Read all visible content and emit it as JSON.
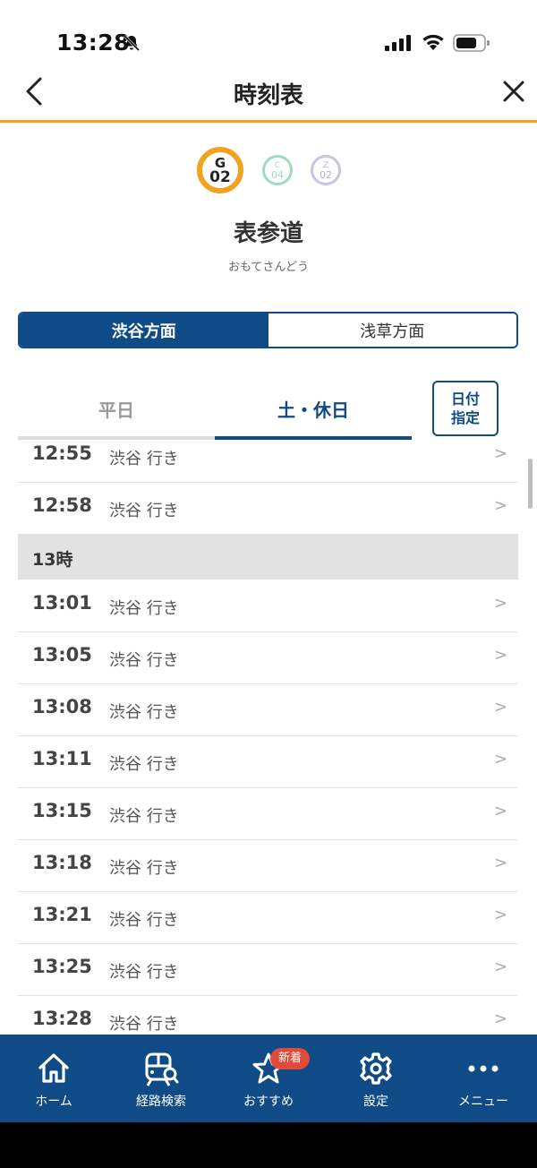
{
  "status_bar": {
    "time": "13:28"
  },
  "header": {
    "title": "時刻表"
  },
  "station": {
    "badges": [
      {
        "letter": "G",
        "number": "02"
      },
      {
        "letter": "C",
        "number": "04"
      },
      {
        "letter": "Z",
        "number": "02"
      }
    ],
    "name": "表参道",
    "reading": "おもてさんどう"
  },
  "directions": [
    {
      "label": "渋谷方面",
      "selected": true
    },
    {
      "label": "浅草方面",
      "selected": false
    }
  ],
  "day_tabs": [
    {
      "label": "平日",
      "selected": false
    },
    {
      "label": "土・休日",
      "selected": true
    }
  ],
  "date_button": {
    "line1": "日付",
    "line2": "指定"
  },
  "timetable": {
    "before": [
      {
        "time": "12:55",
        "dest": "渋谷 行き"
      },
      {
        "time": "12:58",
        "dest": "渋谷 行き"
      }
    ],
    "hour_header": "13時",
    "after": [
      {
        "time": "13:01",
        "dest": "渋谷 行き"
      },
      {
        "time": "13:05",
        "dest": "渋谷 行き"
      },
      {
        "time": "13:08",
        "dest": "渋谷 行き"
      },
      {
        "time": "13:11",
        "dest": "渋谷 行き"
      },
      {
        "time": "13:15",
        "dest": "渋谷 行き"
      },
      {
        "time": "13:18",
        "dest": "渋谷 行き"
      },
      {
        "time": "13:21",
        "dest": "渋谷 行き"
      },
      {
        "time": "13:25",
        "dest": "渋谷 行き"
      },
      {
        "time": "13:28",
        "dest": "渋谷 行き"
      }
    ],
    "chevron": ">"
  },
  "tab_bar": {
    "items": [
      {
        "label": "ホーム",
        "icon": "home-icon"
      },
      {
        "label": "経路検索",
        "icon": "train-search-icon"
      },
      {
        "label": "おすすめ",
        "icon": "star-icon"
      },
      {
        "label": "設定",
        "icon": "gear-icon"
      },
      {
        "label": "メニュー",
        "icon": "more-dots-icon"
      }
    ],
    "new_badge": "新着"
  },
  "colors": {
    "primary": "#0f4b86",
    "accent": "#f0a31e",
    "badge_red": "#e14b3b"
  }
}
